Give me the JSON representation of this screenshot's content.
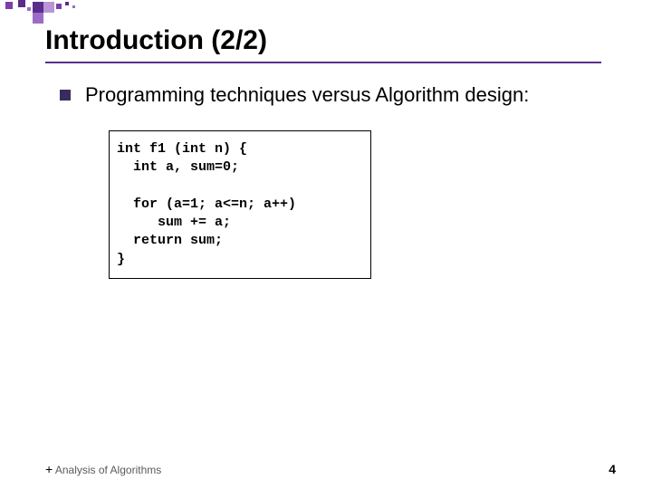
{
  "title": "Introduction (2/2)",
  "bullet": "Programming techniques versus Algorithm design:",
  "code": "int f1 (int n) {\n  int a, sum=0;\n\n  for (a=1; a<=n; a++)\n     sum += a;\n  return sum;\n}",
  "footer": {
    "plus": "+",
    "text": " Analysis of Algorithms",
    "page": "4"
  },
  "underline_width": 614
}
